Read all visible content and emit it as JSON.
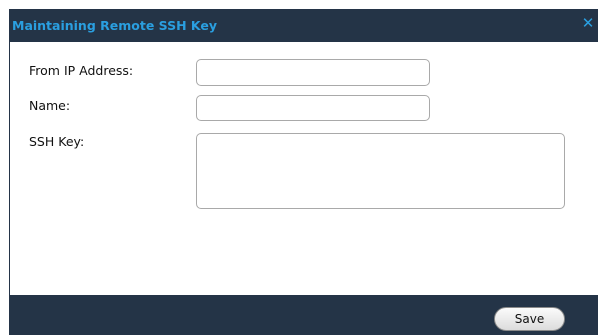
{
  "dialog": {
    "title": "Maintaining Remote SSH Key",
    "close_glyph": "✕",
    "close_icon": "close-icon",
    "accent_color": "#2a9fe0",
    "frame_color": "#243447"
  },
  "form": {
    "from_ip_label": "From IP Address:",
    "from_ip_value": "",
    "name_label": "Name:",
    "name_value": "",
    "ssh_key_label": "SSH Key:",
    "ssh_key_value": ""
  },
  "footer": {
    "save_label": "Save"
  }
}
